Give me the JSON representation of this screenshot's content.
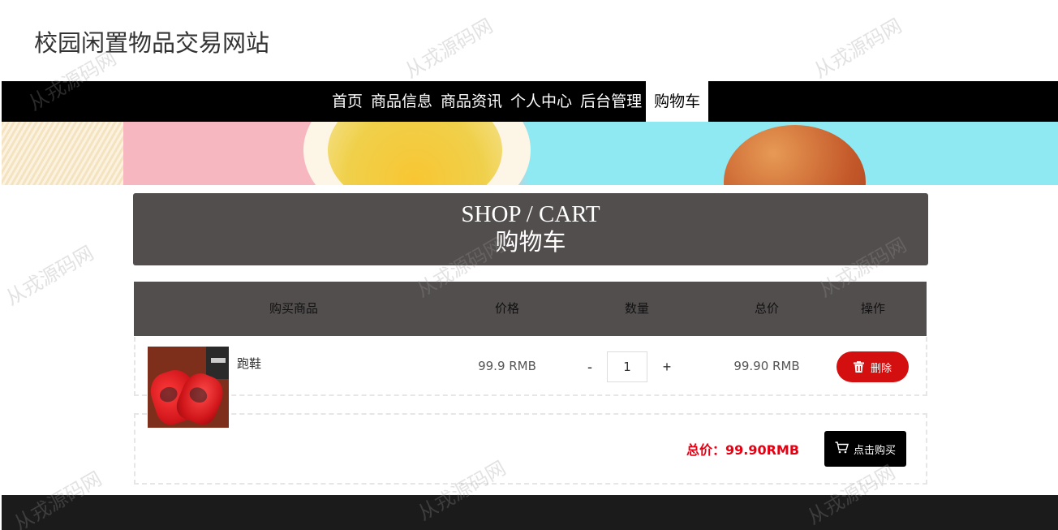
{
  "site": {
    "title": "校园闲置物品交易网站"
  },
  "nav": {
    "items": [
      {
        "label": "首页"
      },
      {
        "label": "商品信息"
      },
      {
        "label": "商品资讯"
      },
      {
        "label": "个人中心"
      },
      {
        "label": "后台管理"
      },
      {
        "label": "购物车",
        "active": true
      }
    ]
  },
  "cart": {
    "title_en": "SHOP / CART",
    "title_cn": "购物车",
    "columns": [
      "购买商品",
      "价格",
      "数量",
      "总价",
      "操作"
    ],
    "items": [
      {
        "name": "跑鞋",
        "price": "99.9 RMB",
        "quantity": "1",
        "minus_label": "-",
        "plus_label": "+",
        "subtotal": "99.90 RMB",
        "delete_label": "删除"
      }
    ],
    "total_label": "总价：99.90RMB",
    "buy_label": "点击购买"
  },
  "watermark": {
    "text": "从戎源码网"
  },
  "colors": {
    "nav_bg": "#000000",
    "header_bg": "#534e4e",
    "delete_button": "#d30f10",
    "total_text": "#e60012",
    "footer_bg": "#1b1b1b"
  },
  "icons": {
    "delete": "trash-icon",
    "buy": "cart-icon"
  }
}
